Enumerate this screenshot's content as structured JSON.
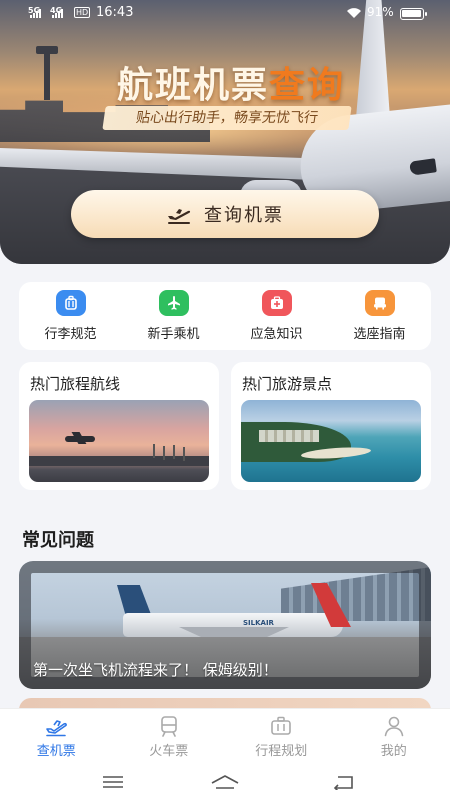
{
  "status_bar": {
    "sig1": "5G",
    "sig2": "4G",
    "hd": "HD",
    "time": "16:43",
    "battery": "91%",
    "battery_level": 0.91
  },
  "hero": {
    "title_main": "航班机票",
    "title_accent": "查询",
    "subtitle": "贴心出行助手，畅享无忧飞行",
    "button_label": "查询机票",
    "button_icon": "airplane-takeoff-icon",
    "accent_color": "#f07a1e"
  },
  "quick_menu": [
    {
      "label": "行李规范",
      "icon": "luggage-icon",
      "color": "#3b8cf0"
    },
    {
      "label": "新手乘机",
      "icon": "airplane-icon",
      "color": "#2fbf5f"
    },
    {
      "label": "应急知识",
      "icon": "first-aid-icon",
      "color": "#f0565b"
    },
    {
      "label": "选座指南",
      "icon": "seat-icon",
      "color": "#f7953b"
    }
  ],
  "cards": {
    "routes_title": "热门旅程航线",
    "spots_title": "热门旅游景点"
  },
  "faq": {
    "heading": "常见问题",
    "caption": "第一次坐飞机流程来了！ 保姆级别！",
    "jet_label": "SILKAIR"
  },
  "tabs": [
    {
      "label": "查机票",
      "icon": "plane-ticket-icon",
      "active": true
    },
    {
      "label": "火车票",
      "icon": "train-icon",
      "active": false
    },
    {
      "label": "行程规划",
      "icon": "suitcase-icon",
      "active": false
    },
    {
      "label": "我的",
      "icon": "user-icon",
      "active": false
    }
  ],
  "system_nav": {
    "menu": "menu-icon",
    "home": "home-icon",
    "back": "back-icon"
  },
  "colors": {
    "tab_active": "#2f77e6",
    "tab_inactive": "#999999",
    "background": "#f3f4f8"
  }
}
